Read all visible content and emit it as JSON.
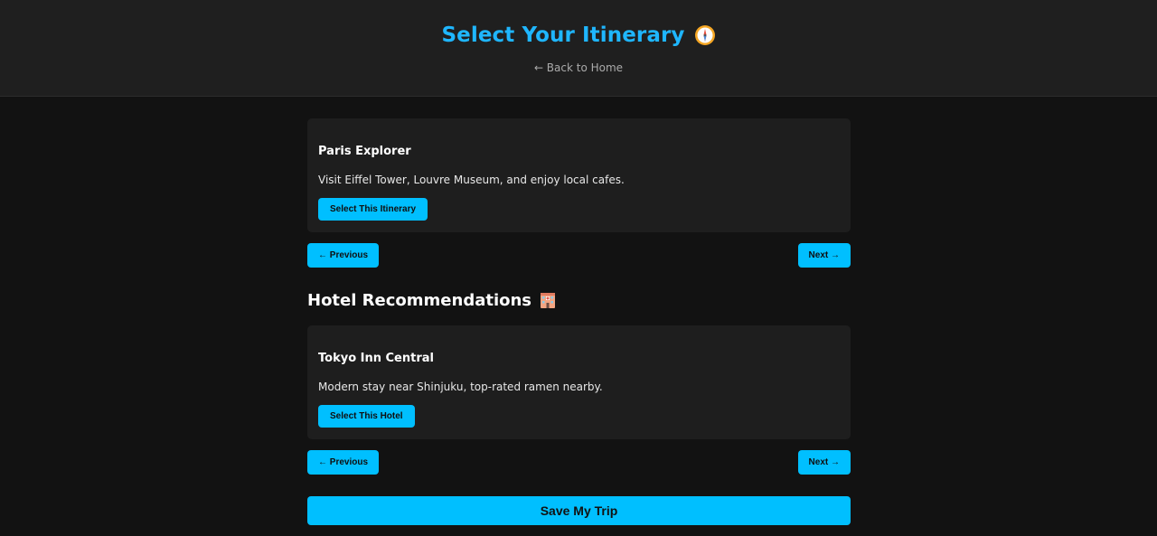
{
  "header": {
    "title": "Select Your Itinerary",
    "title_icon": "compass-icon",
    "back_link": "← Back to Home"
  },
  "itinerary": {
    "card": {
      "title": "Paris Explorer",
      "description": "Visit Eiffel Tower, Louvre Museum, and enjoy local cafes.",
      "select_label": "Select This Itinerary"
    },
    "prev_label": "← Previous",
    "next_label": "Next →"
  },
  "hotels": {
    "section_title": "Hotel Recommendations",
    "section_icon": "hotel-icon",
    "card": {
      "title": "Tokyo Inn Central",
      "description": "Modern stay near Shinjuku, top-rated ramen nearby.",
      "select_label": "Select This Hotel"
    },
    "prev_label": "← Previous",
    "next_label": "Next →"
  },
  "save_label": "Save My Trip",
  "colors": {
    "accent": "#00bfff",
    "title": "#1fb6ff",
    "background": "#121212",
    "header_bg": "#1f1f1f",
    "card_bg": "#1e1e1e"
  }
}
